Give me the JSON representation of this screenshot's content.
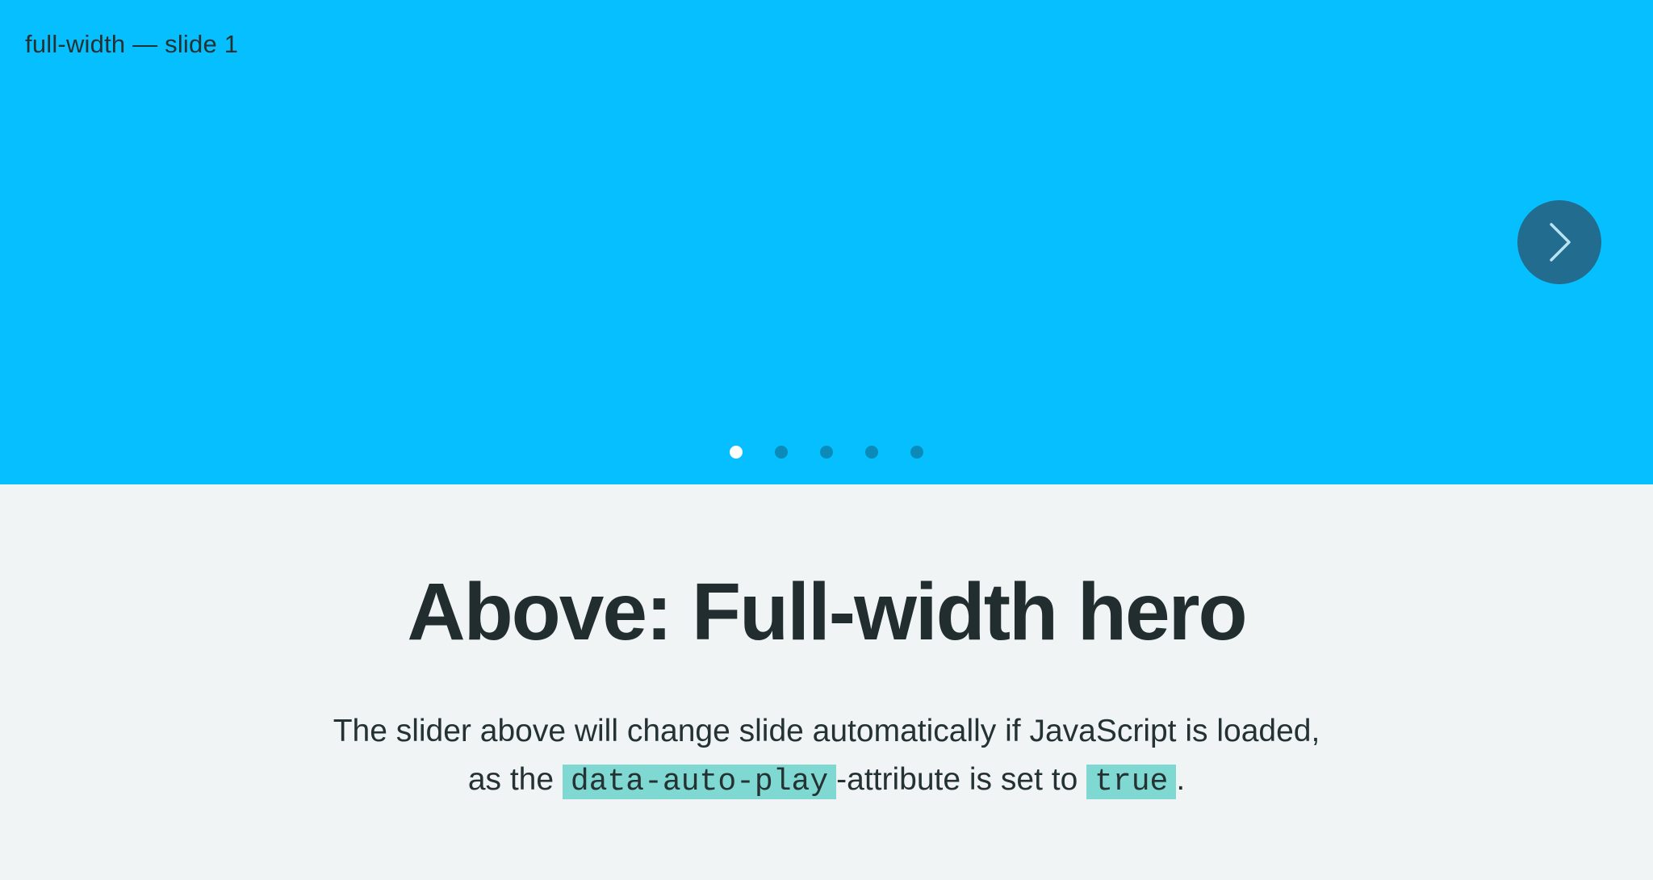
{
  "hero": {
    "slide_label": "full-width — slide 1",
    "background_color": "#05bfff",
    "next_button": {
      "icon": "chevron-right-icon",
      "color": "#216c8f"
    },
    "pagination": {
      "total": 5,
      "active_index": 0,
      "dots": [
        "slide 1",
        "slide 2",
        "slide 3",
        "slide 4",
        "slide 5"
      ]
    }
  },
  "content": {
    "title": "Above: Full-width hero",
    "description": {
      "part1": "The slider above will change slide automatically if JavaScript is loaded,",
      "part2": "as the ",
      "code1": "data-auto-play",
      "part3": "-attribute is set to ",
      "code2": "true",
      "part4": "."
    }
  }
}
